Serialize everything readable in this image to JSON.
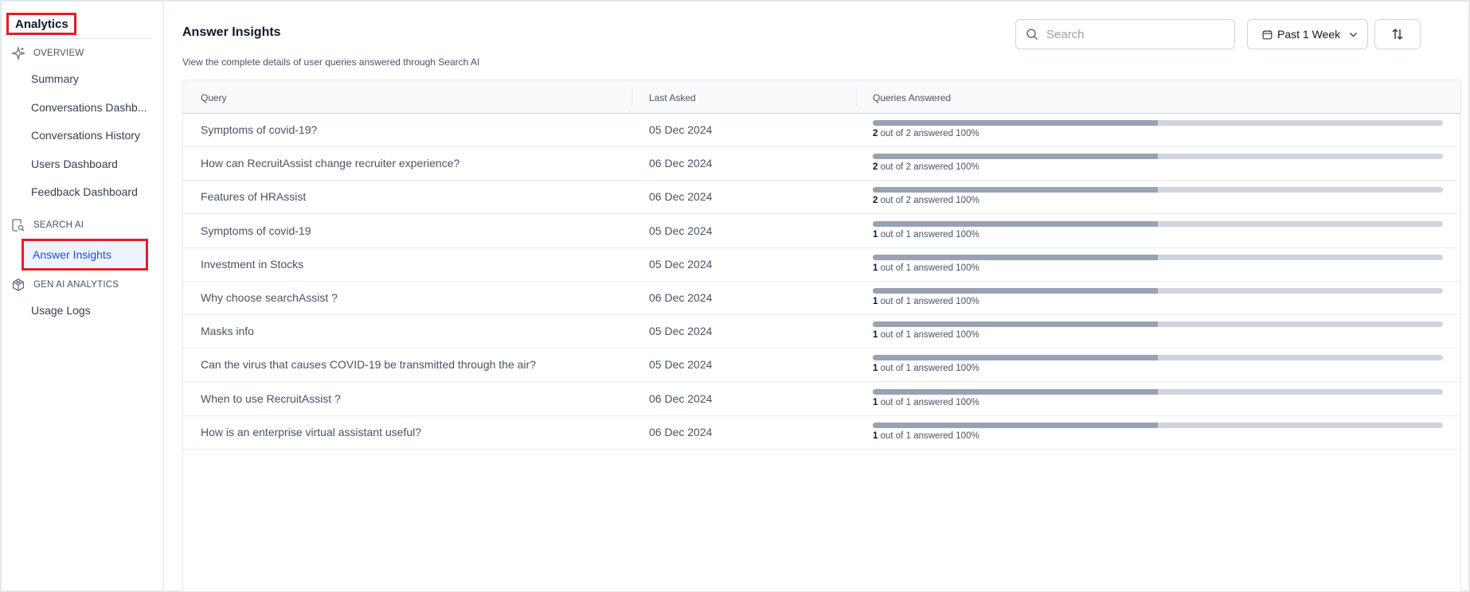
{
  "sidebar": {
    "app_title": "Analytics",
    "sections": [
      {
        "label": "OVERVIEW",
        "icon": "sparkle-icon"
      },
      {
        "label": "SEARCH AI",
        "icon": "document-search-icon"
      },
      {
        "label": "GEN AI ANALYTICS",
        "icon": "cube-network-icon"
      }
    ],
    "overview_items": [
      "Summary",
      "Conversations Dashb...",
      "Conversations History",
      "Users Dashboard",
      "Feedback Dashboard"
    ],
    "search_ai_items": [
      "Answer Insights"
    ],
    "gen_ai_items": [
      "Usage Logs"
    ],
    "active_item": "Answer Insights"
  },
  "header": {
    "title": "Answer Insights",
    "subtitle": "View the complete details of user queries answered through Search AI"
  },
  "toolbar": {
    "search_placeholder": "Search",
    "date_filter": "Past 1 Week",
    "sort_icon": "sort-arrows-icon"
  },
  "table": {
    "columns": [
      "Query",
      "Last Asked",
      "Queries Answered"
    ],
    "answered_text": "out of",
    "answered_suffix": "answered",
    "rows": [
      {
        "query": "Symptoms of covid-19?",
        "date": "05 Dec 2024",
        "answered": "2",
        "total": "2",
        "percent": "100%",
        "fill": 0.5
      },
      {
        "query": "How can RecruitAssist change recruiter experience?",
        "date": "06 Dec 2024",
        "answered": "2",
        "total": "2",
        "percent": "100%",
        "fill": 0.5
      },
      {
        "query": "Features of HRAssist",
        "date": "06 Dec 2024",
        "answered": "2",
        "total": "2",
        "percent": "100%",
        "fill": 0.5
      },
      {
        "query": "Symptoms of covid-19",
        "date": "05 Dec 2024",
        "answered": "1",
        "total": "1",
        "percent": "100%",
        "fill": 0.5
      },
      {
        "query": "Investment in Stocks",
        "date": "05 Dec 2024",
        "answered": "1",
        "total": "1",
        "percent": "100%",
        "fill": 0.5
      },
      {
        "query": "Why choose searchAssist ?",
        "date": "06 Dec 2024",
        "answered": "1",
        "total": "1",
        "percent": "100%",
        "fill": 0.5
      },
      {
        "query": "Masks info",
        "date": "05 Dec 2024",
        "answered": "1",
        "total": "1",
        "percent": "100%",
        "fill": 0.5
      },
      {
        "query": "Can the virus that causes COVID-19 be transmitted through the air?",
        "date": "05 Dec 2024",
        "answered": "1",
        "total": "1",
        "percent": "100%",
        "fill": 0.5
      },
      {
        "query": "When to use RecruitAssist ?",
        "date": "06 Dec 2024",
        "answered": "1",
        "total": "1",
        "percent": "100%",
        "fill": 0.5
      },
      {
        "query": "How is an enterprise virtual assistant useful?",
        "date": "06 Dec 2024",
        "answered": "1",
        "total": "1",
        "percent": "100%",
        "fill": 0.5
      }
    ]
  },
  "colors": {
    "highlight_border": "#e01e2a",
    "active_text": "#1d4ed8",
    "bar_track": "#d0d5dd",
    "bar_fill": "#98a2b3"
  }
}
